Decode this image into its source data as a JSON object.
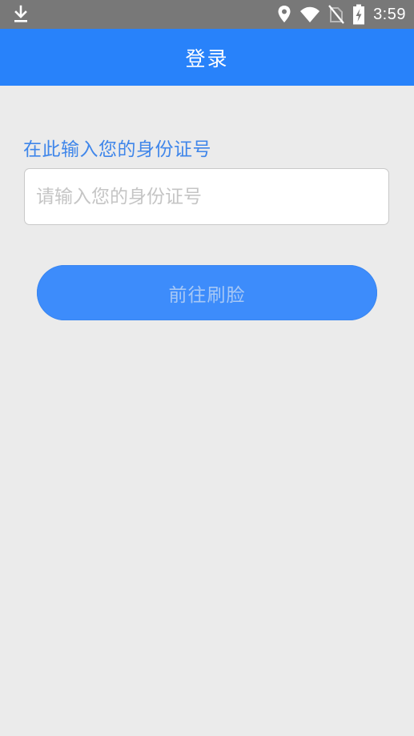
{
  "status_bar": {
    "left_icon": "download-icon",
    "right_icons": [
      "location-icon",
      "wifi-icon",
      "no-sim-icon",
      "battery-charging-icon"
    ],
    "time": "3:59"
  },
  "app_bar": {
    "title": "登录"
  },
  "form": {
    "label": "在此输入您的身份证号",
    "id_input": {
      "value": "",
      "placeholder": "请输入您的身份证号"
    },
    "submit_label": "前往刷脸"
  },
  "colors": {
    "status_bar_bg": "#787878",
    "app_bar_bg": "#2882fa",
    "page_bg": "#ebebeb",
    "label_text": "#3f86ea",
    "button_bg": "#3d8cfb",
    "button_text": "#a7c8f5"
  }
}
